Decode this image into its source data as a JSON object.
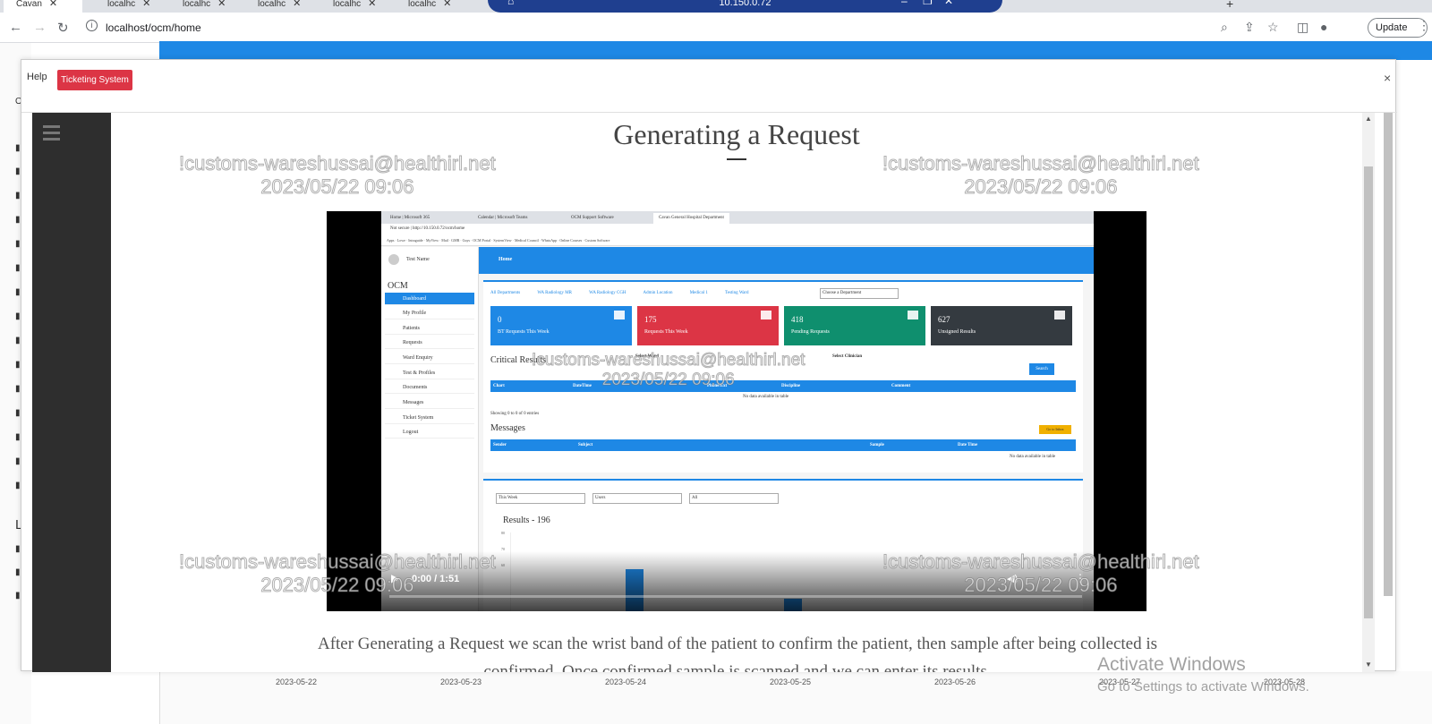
{
  "browser": {
    "tabs": [
      {
        "label": "Cavan"
      },
      {
        "label": "localhc"
      },
      {
        "label": "localhc"
      },
      {
        "label": "localhc"
      },
      {
        "label": "localhc"
      },
      {
        "label": "localhc"
      }
    ],
    "remote_session_label": "10.150.0.72",
    "url": "localhost/ocm/home",
    "update_label": "Update"
  },
  "modal": {
    "help_label": "Help",
    "ticketing_button": "Ticketing System",
    "close_symbol": "×",
    "document": {
      "title": "Generating a Request",
      "paragraph": "After Generating a Request we scan the wrist band of the patient to confirm the patient, then sample after being collected is confirmed. Once confirmed sample is scanned and we can enter its results."
    },
    "video": {
      "time": "0:00 / 1:51",
      "progress": 0.0,
      "frame": {
        "user_name": "Test Name",
        "app_name": "OCM",
        "header_title": "Home",
        "address": "Not secure | http://10.150.0.72/ocm/home",
        "menu": [
          "Dashboard",
          "My Profile",
          "Patients",
          "Requests",
          "Ward Enquiry",
          "Test & Profiles",
          "Documents",
          "Messages",
          "Ticket System",
          "Logout"
        ],
        "departments": [
          "All Departments",
          "WA Radiology MR",
          "WA Radiology CGH",
          "Admin Location",
          "Medical 1",
          "Testing Ward"
        ],
        "department_select": "Choose a Department",
        "cards": [
          {
            "value": "0",
            "label": "BT Requests This Week",
            "color": "#1e88e5"
          },
          {
            "value": "175",
            "label": "Requests This Week",
            "color": "#dc3545"
          },
          {
            "value": "418",
            "label": "Pending Requests",
            "color": "#0f8f6e"
          },
          {
            "value": "627",
            "label": "Unsigned Results",
            "color": "#343a40"
          }
        ],
        "critical_title": "Critical Results",
        "select_ward": "Select Ward",
        "select_clinician": "Select Clinician",
        "search": "Search",
        "critical_columns": [
          "Chart",
          "DateTime",
          "Phone/Ext",
          "Discipline",
          "Comment"
        ],
        "no_data": "No data available in table",
        "showing": "Showing 0 to 0 of 0 entries",
        "messages_title": "Messages",
        "go_inbox": "Go to Inbox",
        "message_columns": [
          "Sender",
          "Subject",
          "Sample",
          "Date Time"
        ],
        "filters": [
          "This Week",
          "Users",
          "All"
        ],
        "results_title": "Results - 196",
        "chart_axis": [
          "80",
          "70",
          "60"
        ],
        "bar_levels": [
          0.9,
          0.3
        ]
      }
    }
  },
  "watermark": {
    "email": "!customs-wareshussai@healthirl.net",
    "datetime": "2023/05/22 09:06"
  },
  "background_dates": [
    "2023-05-22",
    "2023-05-23",
    "2023-05-24",
    "2023-05-25",
    "2023-05-26",
    "2023-05-27",
    "2023-05-28"
  ],
  "os_notice": {
    "title": "Activate Windows",
    "subtitle": "Go to Settings to activate Windows."
  }
}
